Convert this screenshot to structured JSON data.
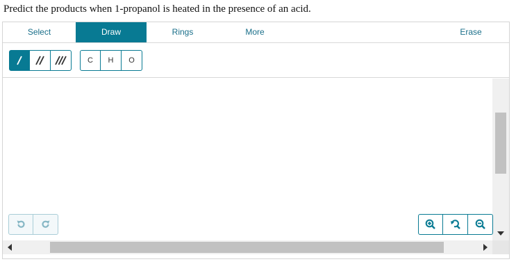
{
  "question": {
    "text": "Predict the products when 1-propanol is heated in the presence of an acid."
  },
  "menu": {
    "tabs": [
      {
        "label": "Select"
      },
      {
        "label": "Draw"
      },
      {
        "label": "Rings"
      },
      {
        "label": "More"
      },
      {
        "label": "Erase"
      }
    ],
    "active": "Draw"
  },
  "tools": {
    "bonds": [
      {
        "icon": "single-bond-icon"
      },
      {
        "icon": "double-bond-icon"
      },
      {
        "icon": "triple-bond-icon"
      }
    ],
    "active_bond": "single-bond-icon",
    "atoms": [
      {
        "label": "C"
      },
      {
        "label": "H"
      },
      {
        "label": "O"
      }
    ]
  },
  "history": {
    "icons": [
      "undo-icon",
      "redo-icon"
    ]
  },
  "zoom": {
    "icons": [
      "zoom-in-icon",
      "zoom-reset-icon",
      "zoom-out-icon"
    ]
  },
  "colors": {
    "accent": "#087a93",
    "link": "#1a6f8a",
    "disabled": "#a9cdd7",
    "scroll_thumb": "#c1c1c1",
    "scroll_track": "#f0f0f0"
  }
}
